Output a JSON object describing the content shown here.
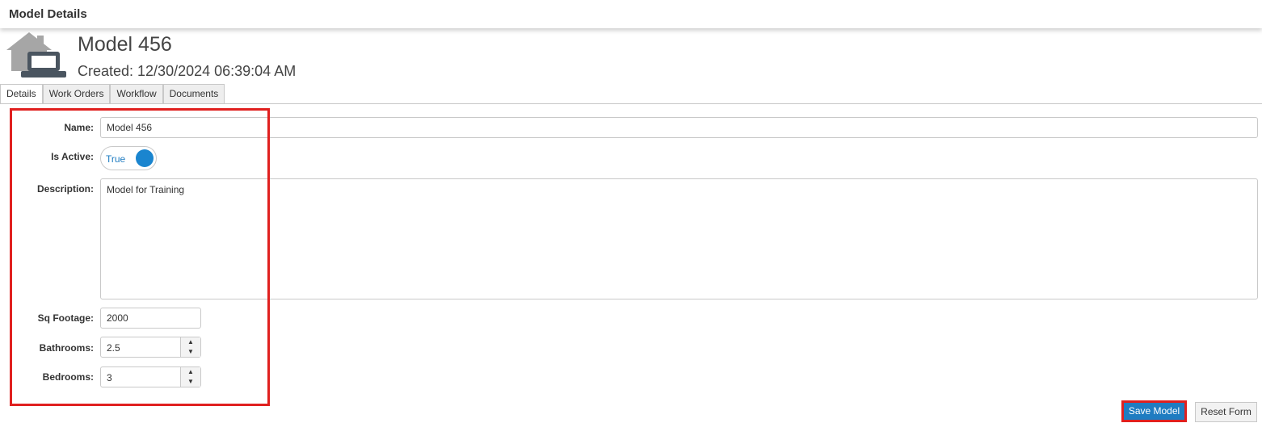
{
  "header": {
    "title": "Model Details"
  },
  "model": {
    "name_heading": "Model 456",
    "created_text": "Created: 12/30/2024 06:39:04 AM",
    "icon": "house-laptop-icon"
  },
  "tabs": [
    {
      "label": "Details",
      "active": true
    },
    {
      "label": "Work Orders",
      "active": false
    },
    {
      "label": "Workflow",
      "active": false
    },
    {
      "label": "Documents",
      "active": false
    }
  ],
  "form": {
    "name": {
      "label": "Name:",
      "value": "Model 456"
    },
    "is_active": {
      "label": "Is Active:",
      "value": "True"
    },
    "description": {
      "label": "Description:",
      "value": "Model for Training"
    },
    "sq_footage": {
      "label": "Sq Footage:",
      "value": "2000"
    },
    "bathrooms": {
      "label": "Bathrooms:",
      "value": "2.5"
    },
    "bedrooms": {
      "label": "Bedrooms:",
      "value": "3"
    }
  },
  "buttons": {
    "save": "Save Model",
    "reset": "Reset Form"
  },
  "colors": {
    "accent": "#1f7cc1",
    "highlight": "#e0201f",
    "icon_gray": "#9a9a9a",
    "icon_dark": "#4a5560"
  }
}
